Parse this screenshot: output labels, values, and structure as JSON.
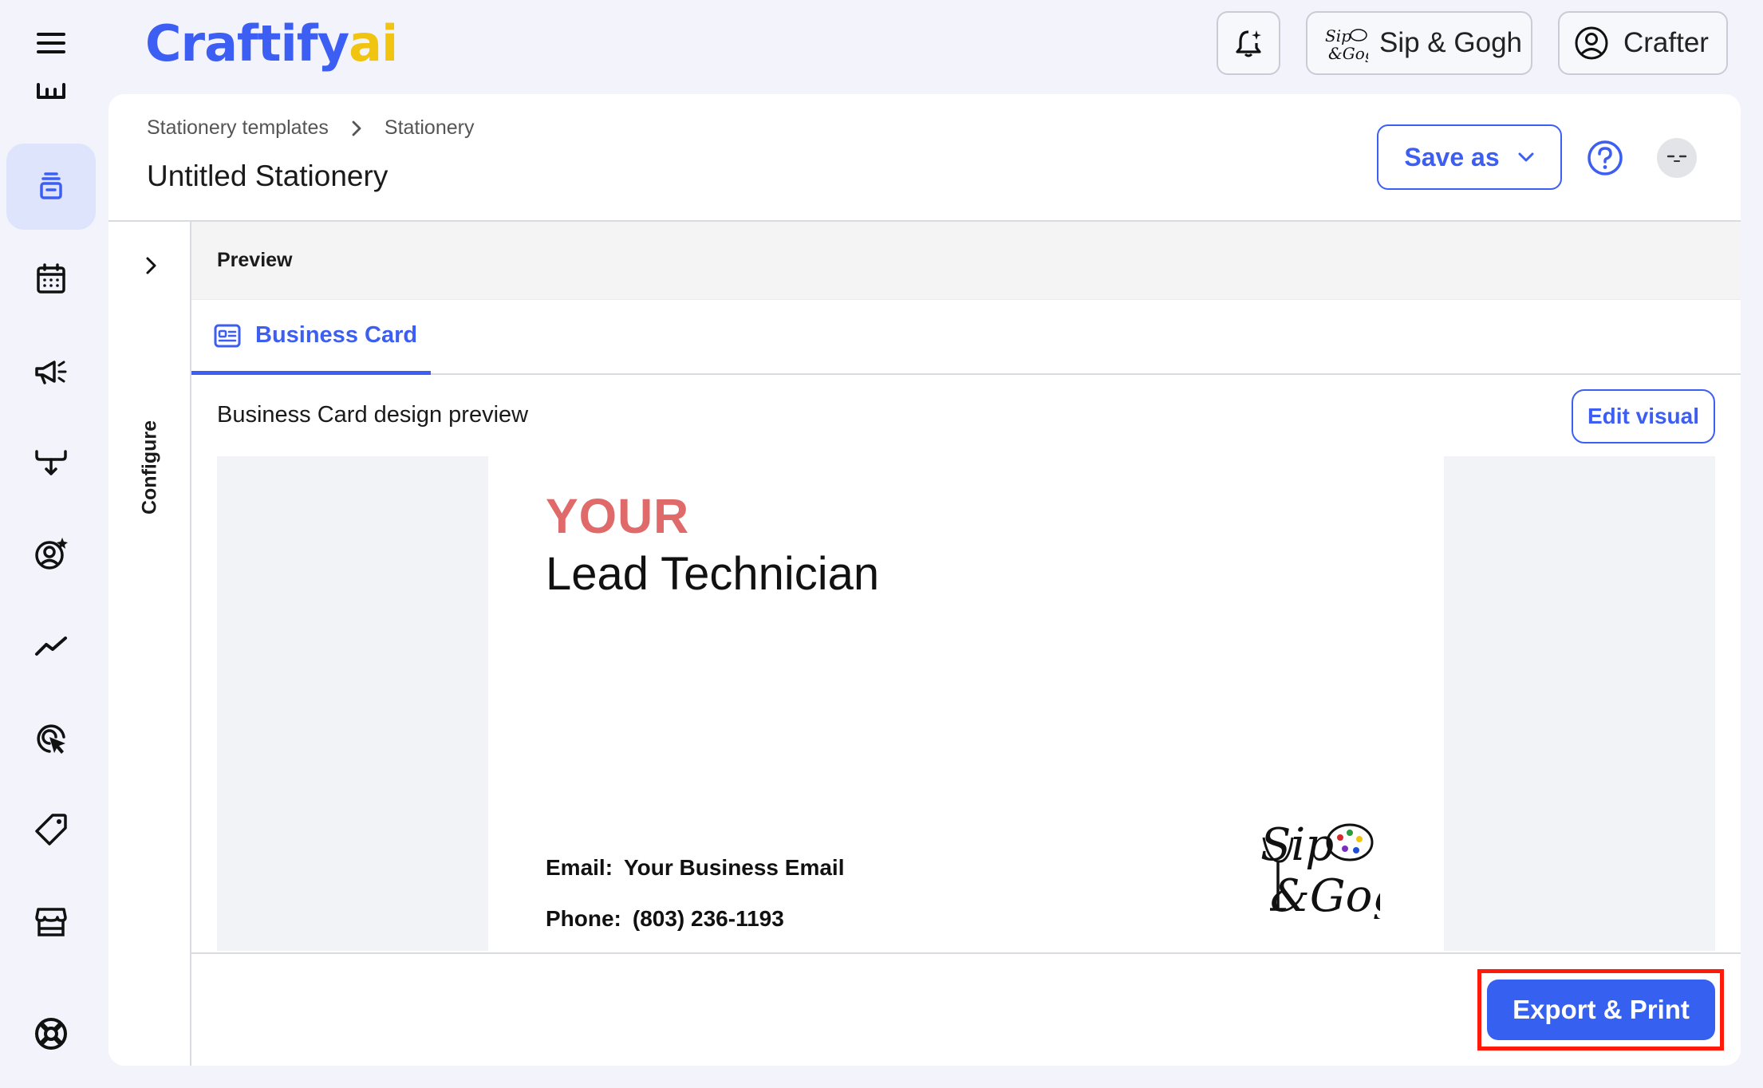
{
  "app": {
    "logo_main": "Craftify",
    "logo_suffix": "ai",
    "brand_color": "#3d5ef2",
    "accent_color": "#f1c40f"
  },
  "topbar": {
    "notification_icon": "bell-sparkle-icon",
    "business_label": "Sip & Gogh",
    "user_label": "Crafter"
  },
  "sidebar": {
    "items": [
      {
        "icon": "building-icon",
        "active": false
      },
      {
        "icon": "stationery-stack-icon",
        "active": true
      },
      {
        "icon": "calendar-icon",
        "active": false
      },
      {
        "icon": "megaphone-icon",
        "active": false
      },
      {
        "icon": "funnel-icon",
        "active": false
      },
      {
        "icon": "user-star-icon",
        "active": false
      },
      {
        "icon": "trend-icon",
        "active": false
      },
      {
        "icon": "target-cursor-icon",
        "active": false
      },
      {
        "icon": "tag-icon",
        "active": false
      },
      {
        "icon": "store-icon",
        "active": false
      },
      {
        "icon": "lifebuoy-icon",
        "active": false
      }
    ]
  },
  "header": {
    "breadcrumb": [
      "Stationery templates",
      "Stationery"
    ],
    "title": "Untitled Stationery",
    "save_as_label": "Save as"
  },
  "configure": {
    "label": "Configure"
  },
  "preview": {
    "section_label": "Preview",
    "tab_label": "Business Card",
    "design_label": "Business Card design preview",
    "edit_visual_label": "Edit visual"
  },
  "card": {
    "first_line": "YOUR",
    "job_title": "Lead Technician",
    "email_key": "Email:",
    "email_value": "Your Business Email",
    "phone_key": "Phone:",
    "phone_value": "(803) 236-1193",
    "first_line_color": "#e06a6a"
  },
  "footer": {
    "export_label": "Export & Print"
  }
}
